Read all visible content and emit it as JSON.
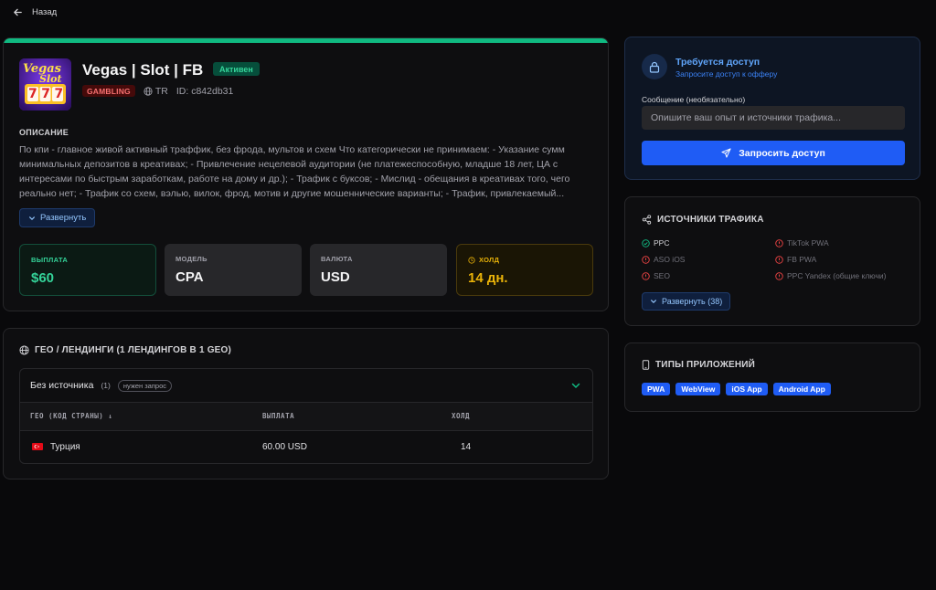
{
  "nav": {
    "back_label": "Назад"
  },
  "offer": {
    "title": "Vegas | Slot | FB",
    "status": "Активен",
    "category": "GAMBLING",
    "geo_code": "TR",
    "id_text": "ID: c842db31",
    "logo_text_top": "Vegas",
    "logo_text_bottom": "Slot",
    "logo_digits": "777",
    "description_heading": "ОПИСАНИЕ",
    "description": "По кпи - главное живой активный траффик, без фрода, мультов и схем Что категорически не принимаем: - Указание сумм минимальных депозитов в креативах; - Привлечение нецелевой аудитории (не платежеспособную, младше 18 лет, ЦА с интересами по быстрым заработкам, работе на дому и др.); - Трафик с буксов; - Мислид - обещания в креативах того, чего реально нет; - Трафик со схем, вэлью, вилок, фрод, мотив и другие мошеннические варианты; - Трафик, привлекаемый...",
    "expand_label": "Развернуть"
  },
  "stats": {
    "payout": {
      "label": "ВЫПЛАТА",
      "value": "$60"
    },
    "model": {
      "label": "МОДЕЛЬ",
      "value": "CPA"
    },
    "currency": {
      "label": "ВАЛЮТА",
      "value": "USD"
    },
    "hold": {
      "label": "ХОЛД",
      "value": "14 дн."
    }
  },
  "geo": {
    "heading": "ГЕО / ЛЕНДИНГИ (1 ЛЕНДИНГОВ В 1 GEO)",
    "source_name": "Без источника",
    "source_count": "(1)",
    "request_badge": "нужен запрос",
    "columns": [
      "ГЕО (КОД СТРАНЫ) ↓",
      "ВЫПЛАТА",
      "ХОЛД"
    ],
    "rows": [
      {
        "country": "Турция",
        "payout": "60.00 USD",
        "hold": "14"
      }
    ]
  },
  "access": {
    "title": "Требуется доступ",
    "subtitle": "Запросите доступ к офферу",
    "message_label": "Сообщение (необязательно)",
    "message_placeholder": "Опишите ваш опыт и источники трафика...",
    "button_label": "Запросить доступ"
  },
  "traffic": {
    "heading": "ИСТОЧНИКИ ТРАФИКА",
    "sources": [
      {
        "name": "PPC",
        "allowed": true
      },
      {
        "name": "TikTok PWA",
        "allowed": false
      },
      {
        "name": "ASO iOS",
        "allowed": false
      },
      {
        "name": "FB PWA",
        "allowed": false
      },
      {
        "name": "SEO",
        "allowed": false
      },
      {
        "name": "PPC Yandex (общие ключи)",
        "allowed": false
      }
    ],
    "expand_label": "Развернуть (38)"
  },
  "apps": {
    "heading": "ТИПЫ ПРИЛОЖЕНИЙ",
    "types": [
      "PWA",
      "WebView",
      "iOS App",
      "Android App"
    ]
  },
  "colors": {
    "accent_green": "#10b981",
    "brand_blue": "#1f5cf5",
    "hold_yellow": "#eab308",
    "danger_red": "#ef4444"
  }
}
